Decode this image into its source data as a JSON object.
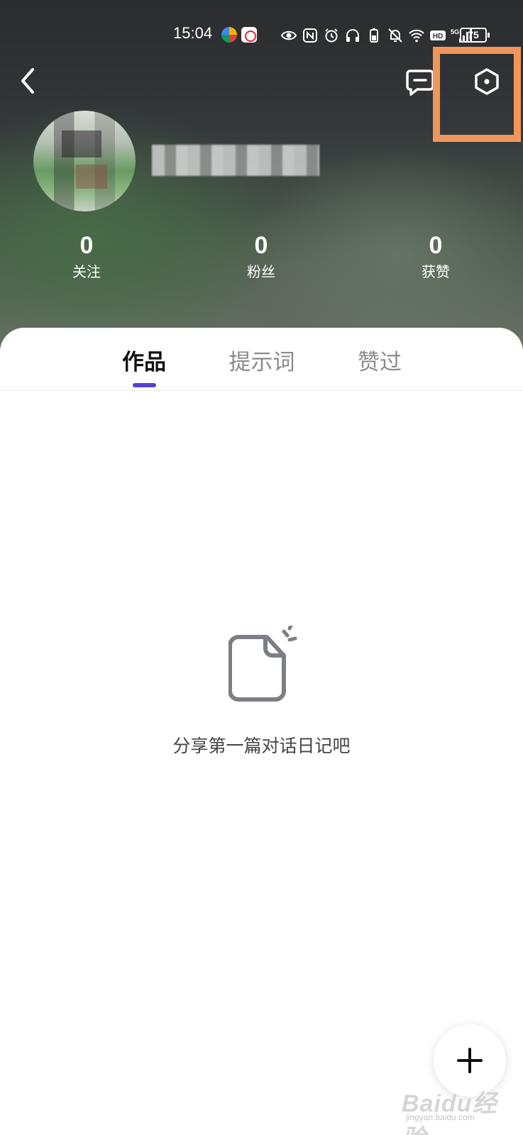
{
  "status_bar": {
    "time": "15:04",
    "battery": "75",
    "icons": [
      "china-unicom-icon",
      "eye-icon",
      "nfc-icon",
      "alarm-icon",
      "headphones-icon",
      "battery-saver-icon",
      "mute-icon",
      "wifi-icon",
      "hd-icon",
      "5g-signal-icon"
    ]
  },
  "nav": {
    "back_icon": "chevron-left-icon",
    "message_icon": "message-icon",
    "settings_icon": "settings-icon"
  },
  "stats": [
    {
      "value": "0",
      "label": "关注"
    },
    {
      "value": "0",
      "label": "粉丝"
    },
    {
      "value": "0",
      "label": "获赞"
    }
  ],
  "tabs": {
    "active": "作品",
    "items": [
      "作品",
      "提示词",
      "赞过"
    ]
  },
  "empty_state": {
    "icon": "document-icon",
    "text": "分享第一篇对话日记吧"
  },
  "fab": {
    "icon": "plus-icon"
  },
  "watermark": {
    "logo": "Baidu经验",
    "url": "jingyan.baidu.com"
  },
  "colors": {
    "accent": "#5b3fd6",
    "highlight": "#f0965a"
  }
}
